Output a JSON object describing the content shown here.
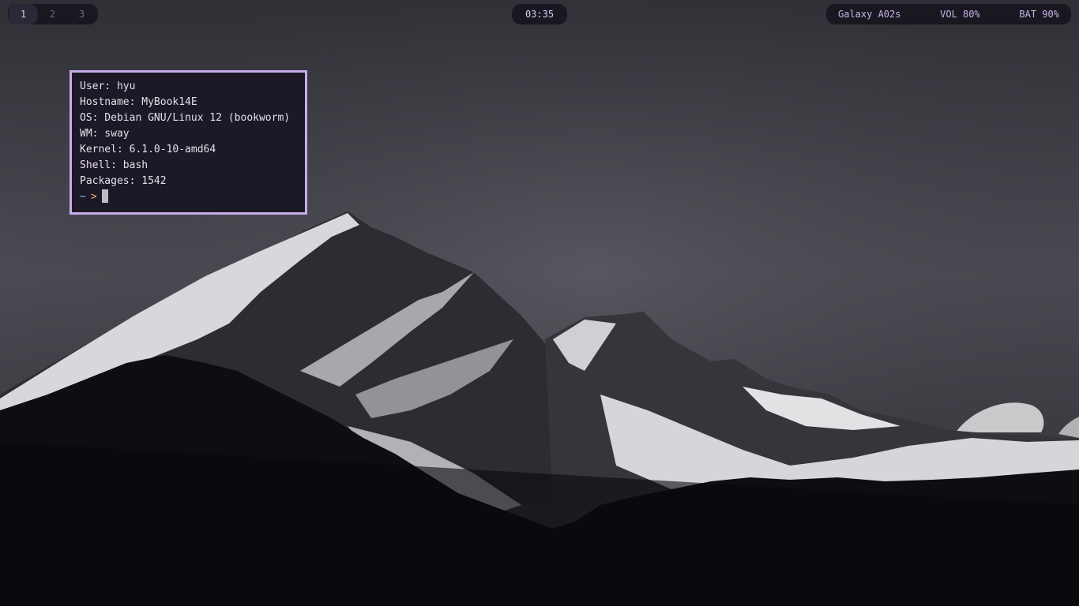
{
  "bar": {
    "workspaces": [
      "1",
      "2",
      "3"
    ],
    "active_workspace": "1",
    "clock": "03:35",
    "device": "Galaxy A02s",
    "volume": "VOL 80%",
    "battery": "BAT 90%"
  },
  "terminal": {
    "lines": [
      "User: hyu",
      "Hostname: MyBook14E",
      "OS: Debian GNU/Linux 12 (bookworm)",
      "WM: sway",
      "Kernel: 6.1.0-10-amd64",
      "Shell: bash",
      "Packages: 1542"
    ],
    "prompt_tilde": "~",
    "prompt_arrow": ">"
  },
  "colors": {
    "accent": "#c9ace8",
    "terminal_bg": "#1c1826",
    "bar_bg": "#16141e"
  }
}
